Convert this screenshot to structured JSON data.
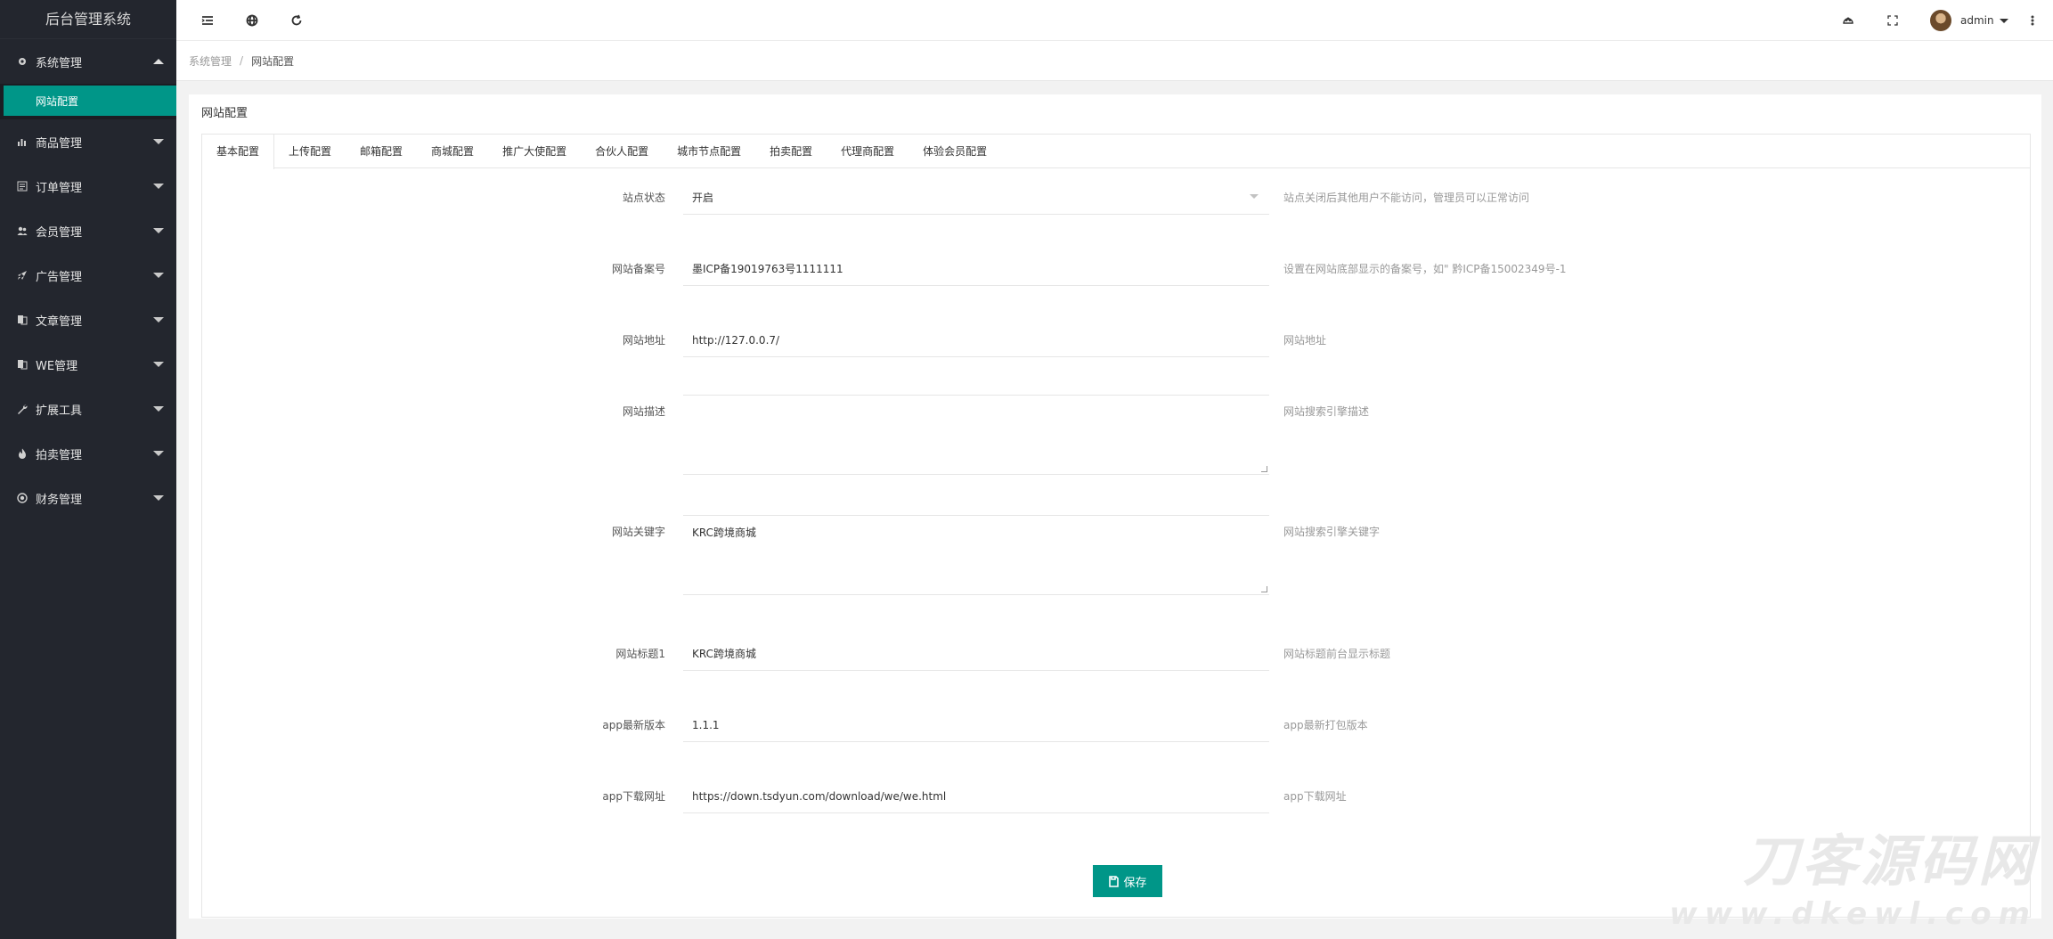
{
  "app": {
    "title": "后台管理系统"
  },
  "sidebar": {
    "items": [
      {
        "label": "系统管理",
        "icon": "gear-icon",
        "expanded": true,
        "sub": [
          {
            "label": "网站配置",
            "active": true
          }
        ]
      },
      {
        "label": "商品管理",
        "icon": "bar-chart-icon"
      },
      {
        "label": "订单管理",
        "icon": "list-icon"
      },
      {
        "label": "会员管理",
        "icon": "users-icon"
      },
      {
        "label": "广告管理",
        "icon": "rocket-icon"
      },
      {
        "label": "文章管理",
        "icon": "document-icon"
      },
      {
        "label": "WE管理",
        "icon": "document-icon"
      },
      {
        "label": "扩展工具",
        "icon": "wrench-icon"
      },
      {
        "label": "拍卖管理",
        "icon": "fire-icon"
      },
      {
        "label": "财务管理",
        "icon": "circle-icon"
      }
    ]
  },
  "header": {
    "icons": [
      "menu-toggle-icon",
      "globe-icon",
      "refresh-icon",
      "theme-icon",
      "fullscreen-icon",
      "more-icon"
    ],
    "user": {
      "name": "admin"
    }
  },
  "breadcrumb": {
    "parent": "系统管理",
    "separator": "/",
    "current": "网站配置"
  },
  "card": {
    "title": "网站配置"
  },
  "tabs": [
    "基本配置",
    "上传配置",
    "邮箱配置",
    "商城配置",
    "推广大使配置",
    "合伙人配置",
    "城市节点配置",
    "拍卖配置",
    "代理商配置",
    "体验会员配置"
  ],
  "form": {
    "fields": [
      {
        "label": "站点状态",
        "value": "开启",
        "tip": "站点关闭后其他用户不能访问，管理员可以正常访问",
        "type": "select"
      },
      {
        "label": "网站备案号",
        "value": "墨ICP备19019763号1111111",
        "tip": "设置在网站底部显示的备案号，如\" 黔ICP备15002349号-1",
        "type": "text"
      },
      {
        "label": "网站地址",
        "value": "http://127.0.0.7/",
        "tip": "网站地址",
        "type": "text"
      },
      {
        "label": "网站描述",
        "value": "",
        "tip": "网站搜索引擎描述",
        "type": "textarea"
      },
      {
        "label": "网站关键字",
        "value": "KRC跨境商城",
        "tip": "网站搜索引擎关键字",
        "type": "textarea"
      },
      {
        "label": "网站标题1",
        "value": "KRC跨境商城",
        "tip": "网站标题前台显示标题",
        "type": "text"
      },
      {
        "label": "app最新版本",
        "value": "1.1.1",
        "tip": "app最新打包版本",
        "type": "text"
      },
      {
        "label": "app下载网址",
        "value": "https://down.tsdyun.com/download/we/we.html",
        "tip": "app下载网址",
        "type": "text"
      }
    ],
    "save_label": "保存"
  },
  "watermark": {
    "line1": "刀客源码网",
    "line2": "www.dkewl.com"
  },
  "colors": {
    "sidebar_bg": "#23262e",
    "accent": "#009688"
  }
}
